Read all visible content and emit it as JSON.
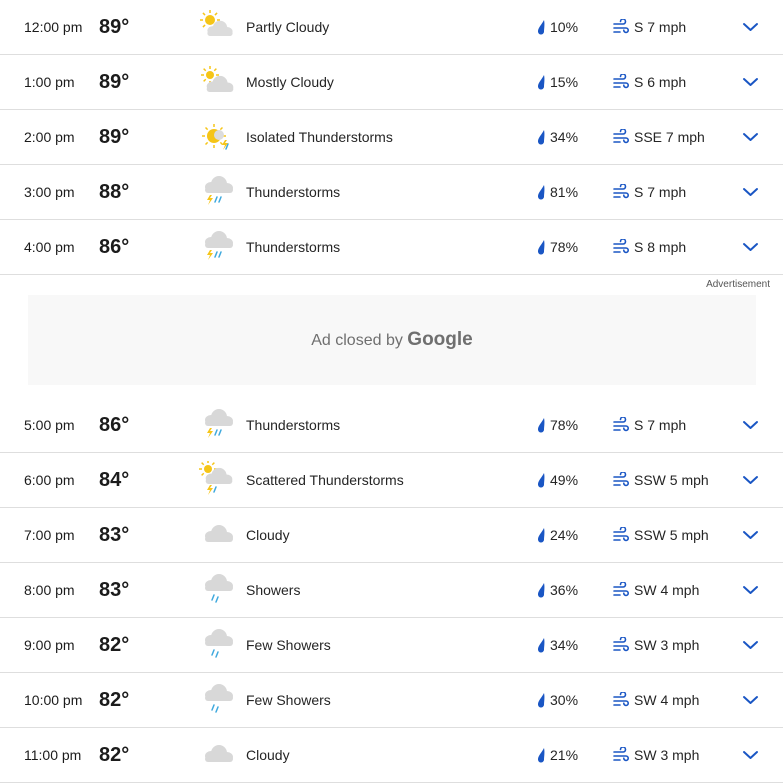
{
  "colors": {
    "accent": "#1a56c4",
    "divider": "#dedede",
    "cloud": "#dcdcdc",
    "sun": "#f5c518",
    "ad_bg": "#f8f8f8"
  },
  "rows": [
    {
      "time": "12:00 pm",
      "temp": "89°",
      "icon": "partly-cloudy",
      "condition": "Partly Cloudy",
      "precip": "10%",
      "wind": "S 7 mph"
    },
    {
      "time": "1:00 pm",
      "temp": "89°",
      "icon": "mostly-cloudy",
      "condition": "Mostly Cloudy",
      "precip": "15%",
      "wind": "S 6 mph"
    },
    {
      "time": "2:00 pm",
      "temp": "89°",
      "icon": "isolated-thunderstorms",
      "condition": "Isolated Thunderstorms",
      "precip": "34%",
      "wind": "SSE 7 mph"
    },
    {
      "time": "3:00 pm",
      "temp": "88°",
      "icon": "thunderstorms",
      "condition": "Thunderstorms",
      "precip": "81%",
      "wind": "S 7 mph"
    },
    {
      "time": "4:00 pm",
      "temp": "86°",
      "icon": "thunderstorms",
      "condition": "Thunderstorms",
      "precip": "78%",
      "wind": "S 8 mph"
    },
    {
      "time": "5:00 pm",
      "temp": "86°",
      "icon": "thunderstorms",
      "condition": "Thunderstorms",
      "precip": "78%",
      "wind": "S 7 mph"
    },
    {
      "time": "6:00 pm",
      "temp": "84°",
      "icon": "scattered-thunderstorms",
      "condition": "Scattered Thunderstorms",
      "precip": "49%",
      "wind": "SSW 5 mph"
    },
    {
      "time": "7:00 pm",
      "temp": "83°",
      "icon": "cloudy",
      "condition": "Cloudy",
      "precip": "24%",
      "wind": "SSW 5 mph"
    },
    {
      "time": "8:00 pm",
      "temp": "83°",
      "icon": "showers",
      "condition": "Showers",
      "precip": "36%",
      "wind": "SW 4 mph"
    },
    {
      "time": "9:00 pm",
      "temp": "82°",
      "icon": "showers",
      "condition": "Few Showers",
      "precip": "34%",
      "wind": "SW 3 mph"
    },
    {
      "time": "10:00 pm",
      "temp": "82°",
      "icon": "showers",
      "condition": "Few Showers",
      "precip": "30%",
      "wind": "SW 4 mph"
    },
    {
      "time": "11:00 pm",
      "temp": "82°",
      "icon": "cloudy",
      "condition": "Cloudy",
      "precip": "21%",
      "wind": "SW 3 mph"
    }
  ],
  "ad": {
    "label": "Advertisement",
    "closed_text": "Ad closed by",
    "brand": "Google"
  }
}
